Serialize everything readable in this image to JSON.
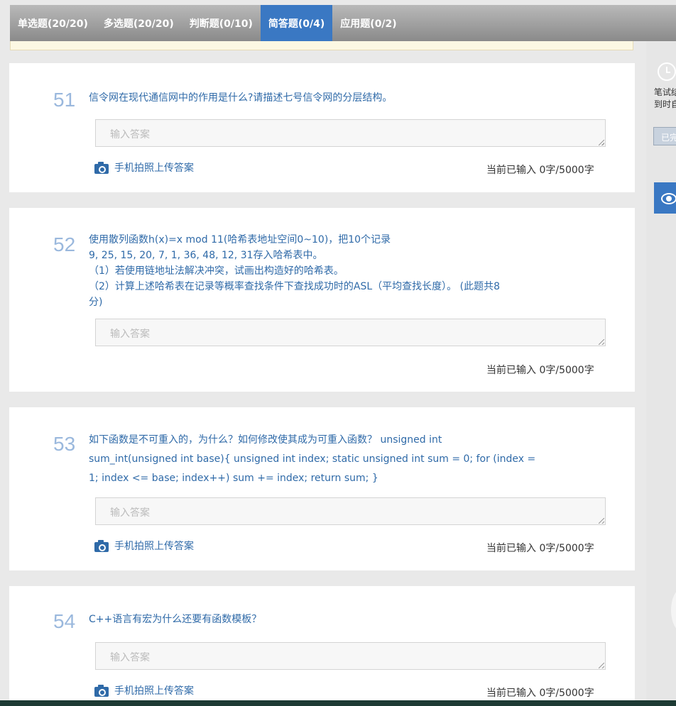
{
  "tabs": [
    {
      "label": "单选题(20/20)",
      "active": false
    },
    {
      "label": "多选题(20/20)",
      "active": false
    },
    {
      "label": "判断题(0/10)",
      "active": false
    },
    {
      "label": "简答题(0/4)",
      "active": true
    },
    {
      "label": "应用题(0/2)",
      "active": false
    }
  ],
  "sidebar": {
    "timer_text_line1": "笔试结",
    "timer_text_line2": "到时自",
    "status_button": "已完",
    "clock_icon": "clock-icon",
    "eye_icon": "eye-icon"
  },
  "common": {
    "answer_placeholder": "输入答案",
    "upload_label": "手机拍照上传答案",
    "camera_icon": "camera-icon",
    "counter": "当前已输入 0字/5000字"
  },
  "questions": [
    {
      "num": "51",
      "text": "信令网在现代通信网中的作用是什么?请描述七号信令网的分层结构。"
    },
    {
      "num": "52",
      "text": "使用散列函数h(x)=x mod 11(哈希表地址空间0~10)，把10个记录\n9, 25, 15, 20, 7, 1, 36, 48, 12, 31存入哈希表中。\n（1）若使用链地址法解决冲突，试画出构造好的哈希表。\n（2）计算上述哈希表在记录等概率查找条件下查找成功时的ASL（平均查找长度）。 (此题共8\n分)"
    },
    {
      "num": "53",
      "text": "如下函数是不可重入的，为什么？如何修改使其成为可重入函数？ unsigned int\nsum_int(unsigned int base){ unsigned int index; static unsigned int sum = 0; for (index =\n1; index <= base; index++) sum += index; return sum; }"
    },
    {
      "num": "54",
      "text": "C++语言有宏为什么还要有函数模板？"
    }
  ],
  "colors": {
    "accent": "#3a78c3",
    "question_text": "#2f6aa8",
    "question_number": "#9ab8dd"
  }
}
